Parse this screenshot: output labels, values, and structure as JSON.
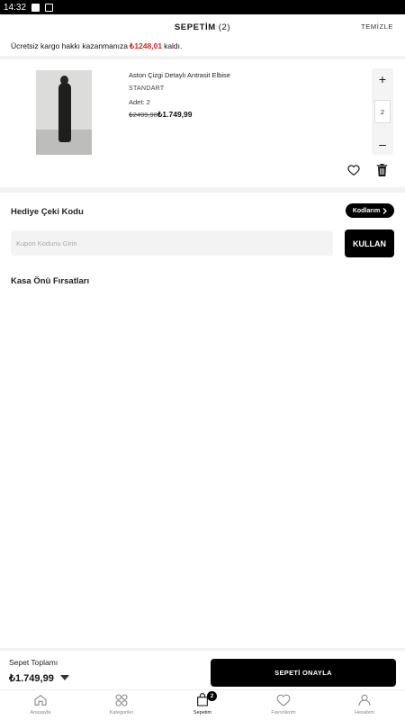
{
  "status_bar": {
    "time": "14:32"
  },
  "header": {
    "title": "SEPETİM",
    "count": "(2)",
    "clear_label": "TEMİZLE"
  },
  "shipping_notice": {
    "prefix": "Ücretsiz kargo hakkı kazanmanıza",
    "amount": "₺1248,01",
    "suffix": "kaldı.",
    "amount_color": "#e2231a"
  },
  "cart_item": {
    "name": "Aston Çizgi Detaylı Antrasit Elbise",
    "size": "STANDART",
    "quantity_label": "Adet: 2",
    "old_price": "₺2499,98",
    "new_price": "₺1.749,99",
    "stepper": {
      "plus": "+",
      "value": "2",
      "minus": "–"
    },
    "icons": [
      "heart-icon",
      "trash-icon"
    ]
  },
  "gift": {
    "title": "Hediye Çeki Kodu",
    "codes_button": "Kodlarım",
    "input_placeholder": "Kupon Kodunu Girin",
    "use_button": "KULLAN"
  },
  "opportunities": {
    "title": "Kasa Önü Fırsatları"
  },
  "footer": {
    "total_label": "Sepet Toplamı",
    "total_value": "₺1.749,99",
    "confirm_button": "SEPETİ ONAYLA"
  },
  "tabs": [
    {
      "label": "Anasayfa",
      "icon": "home-icon"
    },
    {
      "label": "Kategoriler",
      "icon": "grid-icon"
    },
    {
      "label": "Sepetim",
      "icon": "bag-icon",
      "badge": "2",
      "active": true
    },
    {
      "label": "Favorilerim",
      "icon": "heart-icon"
    },
    {
      "label": "Hesabım",
      "icon": "user-icon"
    }
  ],
  "colors": {
    "accent": "#000000",
    "sale": "#e2231a"
  }
}
